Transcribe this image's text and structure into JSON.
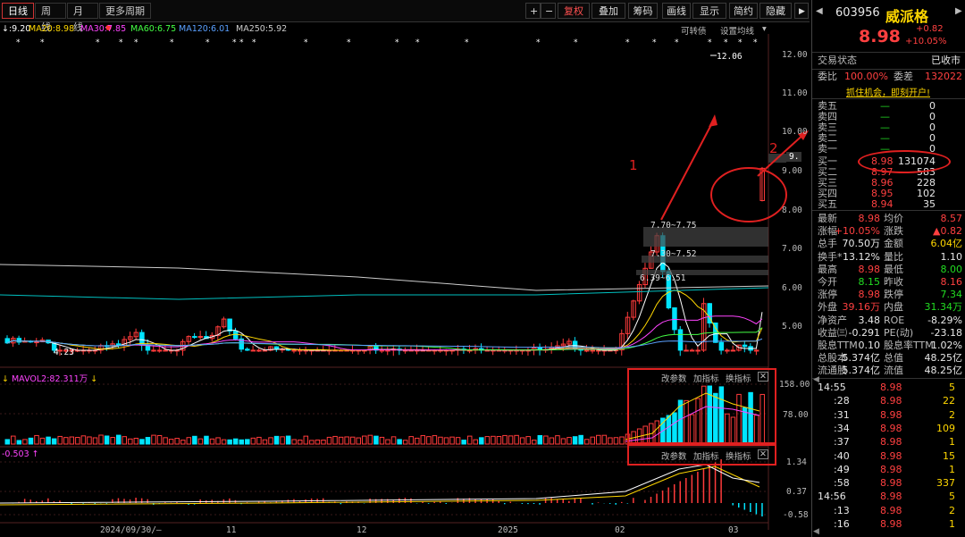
{
  "toolbar": {
    "tabs": [
      "日线",
      "周线",
      "月线",
      "更多周期"
    ],
    "buttons": [
      "+",
      "−",
      "复权",
      "叠加",
      "筹码",
      "画线",
      "显示",
      "简约",
      "隐藏"
    ]
  },
  "ma_legend": [
    {
      "text": "↓:9.20",
      "color": "#ffffff"
    },
    {
      "text": "MA20:8.98",
      "color": "#ffd700"
    },
    {
      "text": "MA30:7.85",
      "color": "#ff44ff"
    },
    {
      "text": "MA60:6.75",
      "color": "#44ff44"
    },
    {
      "text": "MA120:6.01",
      "color": "#5aa0ff"
    },
    {
      "text": "MA250:5.92",
      "color": "#cccccc"
    }
  ],
  "chart_top_labels": {
    "convertible": "可转债",
    "settings": "设置均线"
  },
  "price_axis": [
    "12.00",
    "11.00",
    "10.00",
    "9.",
    "9.00",
    "8.00",
    "7.00",
    "6.00",
    "5.00"
  ],
  "annotations": {
    "peak": "12.06",
    "low": "4.23",
    "band1": "7.70~7.75",
    "band2": "7.30~7.52",
    "band3": "6.39~6.51",
    "arrow1": "1",
    "arrow2": "2"
  },
  "volume": {
    "label": "MAVOL2:82.311万",
    "axis": [
      "158.00",
      "78.00"
    ],
    "buttons": [
      "改参数",
      "加指标",
      "换指标"
    ]
  },
  "macd": {
    "label": "-0.503",
    "axis": [
      "1.34",
      "0.37",
      "-0.58"
    ],
    "buttons": [
      "改参数",
      "加指标",
      "换指标"
    ]
  },
  "date_axis": [
    "2024/09/30/—",
    "11",
    "12",
    "2025",
    "02",
    "03"
  ],
  "stock": {
    "code": "603956",
    "name": "威派格",
    "price": "8.98",
    "change": "+0.82",
    "pct": "+10.05%"
  },
  "status": {
    "label": "交易状态",
    "value": "已收市"
  },
  "ratio": {
    "wb_label": "委比",
    "wb": "100.00%",
    "wc_label": "委差",
    "wc": "132022"
  },
  "promo": "抓住机会，即刻开户!",
  "asks": [
    {
      "label": "卖五",
      "price": "—",
      "vol": "0"
    },
    {
      "label": "卖四",
      "price": "—",
      "vol": "0"
    },
    {
      "label": "卖三",
      "price": "—",
      "vol": "0"
    },
    {
      "label": "卖二",
      "price": "—",
      "vol": "0"
    },
    {
      "label": "卖一",
      "price": "—",
      "vol": "0"
    }
  ],
  "bids": [
    {
      "label": "买一",
      "price": "8.98",
      "vol": "131074"
    },
    {
      "label": "买二",
      "price": "8.97",
      "vol": "583"
    },
    {
      "label": "买三",
      "price": "8.96",
      "vol": "228"
    },
    {
      "label": "买四",
      "price": "8.95",
      "vol": "102"
    },
    {
      "label": "买五",
      "price": "8.94",
      "vol": "35"
    }
  ],
  "stats": [
    [
      "最新",
      "8.98",
      "均价",
      "8.57"
    ],
    [
      "涨幅",
      "+10.05%",
      "涨跌",
      "▲0.82"
    ],
    [
      "总手",
      "70.50万",
      "金额",
      "6.04亿"
    ],
    [
      "换手*",
      "13.12%",
      "量比",
      "1.10"
    ],
    [
      "最高",
      "8.98",
      "最低",
      "8.00"
    ],
    [
      "今开",
      "8.15",
      "昨收",
      "8.16"
    ],
    [
      "涨停",
      "8.98",
      "跌停",
      "7.34"
    ],
    [
      "外盘",
      "39.16万",
      "内盘",
      "31.34万"
    ],
    [
      "净资产",
      "3.48",
      "ROE",
      "-8.29%"
    ],
    [
      "收益㈢",
      "-0.291",
      "PE(动)",
      "-23.18"
    ],
    [
      "股息TTM",
      "0.10",
      "股息率TTM",
      "1.02%"
    ],
    [
      "总股本",
      "5.374亿",
      "总值",
      "48.25亿"
    ],
    [
      "流通股",
      "5.374亿",
      "流值",
      "48.25亿"
    ]
  ],
  "ticks": [
    {
      "time": "14:55",
      "price": "8.98",
      "vol": "5"
    },
    {
      "time": ":28",
      "price": "8.98",
      "vol": "22"
    },
    {
      "time": ":31",
      "price": "8.98",
      "vol": "2"
    },
    {
      "time": ":34",
      "price": "8.98",
      "vol": "109"
    },
    {
      "time": ":37",
      "price": "8.98",
      "vol": "1"
    },
    {
      "time": ":40",
      "price": "8.98",
      "vol": "15"
    },
    {
      "time": ":49",
      "price": "8.98",
      "vol": "1"
    },
    {
      "time": ":58",
      "price": "8.98",
      "vol": "337"
    },
    {
      "time": "14:56",
      "price": "8.98",
      "vol": "5"
    },
    {
      "time": ":13",
      "price": "8.98",
      "vol": "2"
    },
    {
      "time": ":16",
      "price": "8.98",
      "vol": "1"
    }
  ],
  "colors": {
    "up": "#ff3b3b",
    "down": "#00e5ff",
    "bg": "#000000",
    "grid": "#3a0000"
  }
}
